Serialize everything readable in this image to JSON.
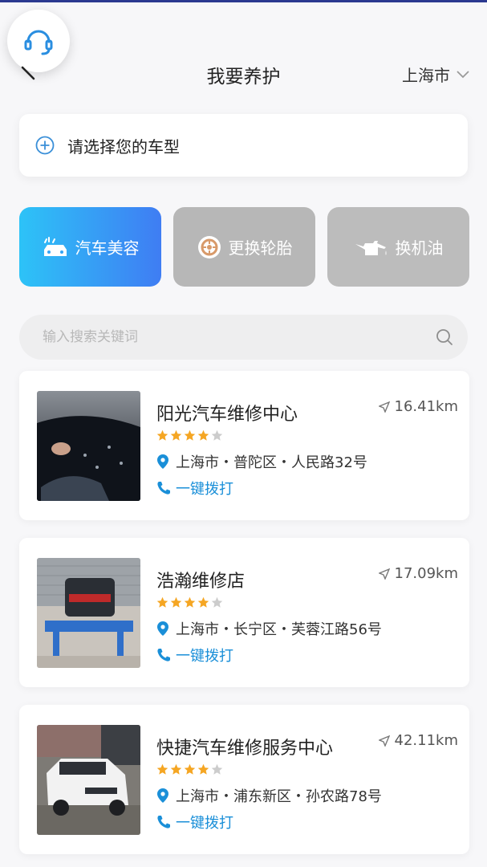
{
  "header": {
    "title": "我要养护",
    "city": "上海市"
  },
  "car_model": {
    "label": "请选择您的车型"
  },
  "categories": [
    {
      "label": "汽车美容",
      "icon": "car-wash-icon",
      "active": true
    },
    {
      "label": "更换轮胎",
      "icon": "tire-icon",
      "active": false
    },
    {
      "label": "换机油",
      "icon": "oil-can-icon",
      "active": false
    }
  ],
  "search": {
    "placeholder": "输入搜索关键词"
  },
  "shops": [
    {
      "name": "阳光汽车维修中心",
      "distance": "16.41km",
      "rating": 4,
      "max_rating": 5,
      "address": "上海市・普陀区・人民路32号",
      "call_label": "一键拨打"
    },
    {
      "name": "浩瀚维修店",
      "distance": "17.09km",
      "rating": 4,
      "max_rating": 5,
      "address": "上海市・长宁区・芙蓉江路56号",
      "call_label": "一键拨打"
    },
    {
      "name": "快捷汽车维修服务中心",
      "distance": "42.11km",
      "rating": 4,
      "max_rating": 5,
      "address": "上海市・浦东新区・孙农路78号",
      "call_label": "一键拨打"
    }
  ],
  "colors": {
    "accent": "#1a8fd8",
    "star_filled": "#f5a623",
    "star_empty": "#cccccc",
    "active_gradient_start": "#2dc3f7",
    "active_gradient_end": "#3f7df3"
  }
}
